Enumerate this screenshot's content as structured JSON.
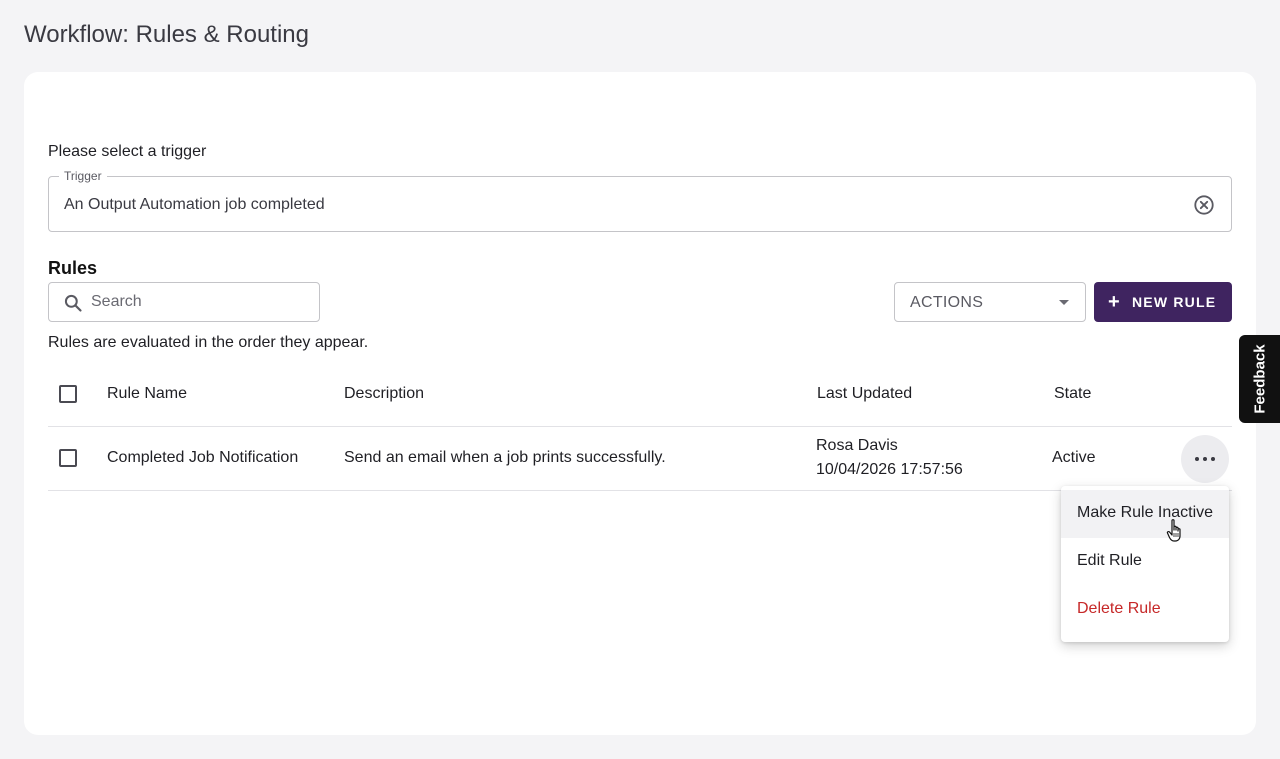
{
  "page": {
    "title": "Workflow: Rules & Routing"
  },
  "trigger": {
    "prompt": "Please select a trigger",
    "legend": "Trigger",
    "value": "An Output Automation job completed"
  },
  "rules": {
    "heading": "Rules",
    "search_placeholder": "Search",
    "actions_label": "ACTIONS",
    "new_rule_label": "NEW RULE",
    "order_note": "Rules are evaluated in the order they appear.",
    "columns": [
      "Rule Name",
      "Description",
      "Last Updated",
      "State"
    ],
    "rows": [
      {
        "name": "Completed Job Notification",
        "description": "Send an email when a job prints successfully.",
        "updated_by": "Rosa Davis",
        "updated_at": "10/04/2026 17:57:56",
        "state": "Active"
      }
    ]
  },
  "row_menu": {
    "items": [
      {
        "label": "Make Rule Inactive",
        "state": "hover"
      },
      {
        "label": "Edit Rule"
      },
      {
        "label": "Delete Rule",
        "color": "#c62828"
      }
    ]
  },
  "feedback": {
    "label": "Feedback"
  },
  "colors": {
    "primary": "#3f2460",
    "danger": "#c62828",
    "background": "#f4f4f6"
  }
}
